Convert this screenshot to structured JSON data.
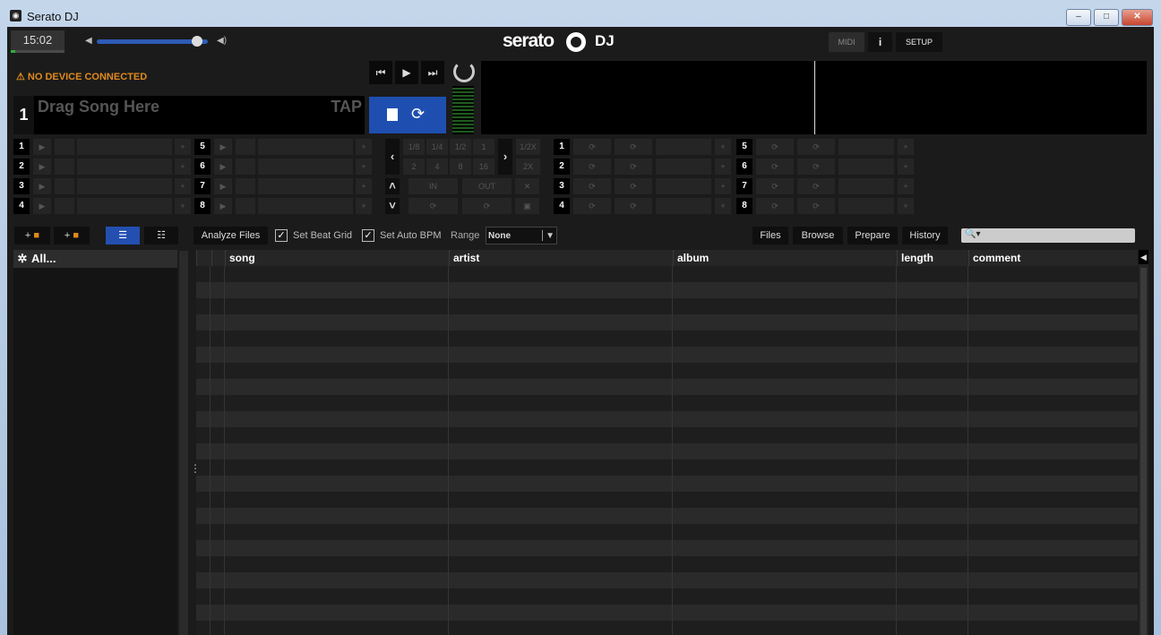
{
  "window": {
    "title": "Serato DJ",
    "minimize": "–",
    "maximize": "□",
    "close": "✕"
  },
  "topbar": {
    "clock": "15:02",
    "volume_level": 0.9,
    "logo_text": "serato",
    "logo_dj": "DJ",
    "midi_label": "MIDI",
    "info_label": "i",
    "setup_label": "SETUP"
  },
  "deck": {
    "warning": "NO DEVICE CONNECTED",
    "number": "1",
    "drag_text": "Drag Song Here",
    "tap_label": "TAP"
  },
  "left_pads": {
    "numbers_a": [
      "1",
      "2",
      "3",
      "4"
    ],
    "numbers_b": [
      "5",
      "6",
      "7",
      "8"
    ]
  },
  "loop_controls": {
    "row1": [
      "1/8",
      "1/4",
      "1/2",
      "1",
      "1/2X"
    ],
    "row2": [
      "2",
      "4",
      "8",
      "16",
      "2X"
    ],
    "in_label": "IN",
    "out_label": "OUT"
  },
  "right_pads": {
    "numbers_a": [
      "1",
      "2",
      "3",
      "4"
    ],
    "numbers_b": [
      "5",
      "6",
      "7",
      "8"
    ]
  },
  "library_toolbar": {
    "analyze_files": "Analyze Files",
    "set_beat_grid": "Set Beat Grid",
    "set_auto_bpm": "Set Auto BPM",
    "range_label": "Range",
    "range_value": "None",
    "files": "Files",
    "browse": "Browse",
    "prepare": "Prepare",
    "history": "History"
  },
  "crates": {
    "all": "All..."
  },
  "table": {
    "columns": [
      "song",
      "artist",
      "album",
      "length",
      "comment"
    ]
  },
  "colors": {
    "accent_blue": "#234fb0",
    "warning_orange": "#e08a1e",
    "background": "#1b1b1b"
  }
}
